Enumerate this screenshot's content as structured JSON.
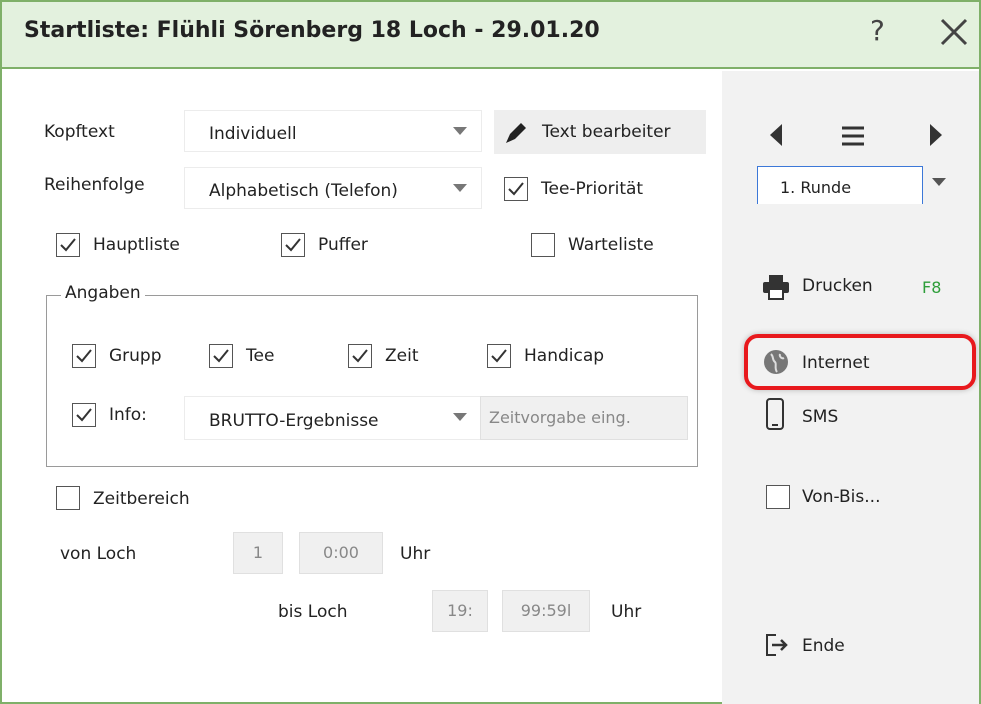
{
  "window": {
    "title": "Startliste: Flühli Sörenberg 18 Loch - 29.01.20",
    "help_glyph": "?"
  },
  "form": {
    "kopftext_label": "Kopftext",
    "kopftext_value": "Individuell",
    "text_bearbeiten_label": "Text bearbeiter",
    "reihenfolge_label": "Reihenfolge",
    "reihenfolge_value": "Alphabetisch (Telefon)",
    "tee_prioritaet_label": "Tee-Priorität",
    "tee_prioritaet_checked": true,
    "hauptliste_label": "Hauptliste",
    "hauptliste_checked": true,
    "puffer_label": "Puffer",
    "puffer_checked": true,
    "warteliste_label": "Warteliste",
    "warteliste_checked": false
  },
  "angaben": {
    "legend": "Angaben",
    "grupp_label": "Grupp",
    "grupp_checked": true,
    "tee_label": "Tee",
    "tee_checked": true,
    "zeit_label": "Zeit",
    "zeit_checked": true,
    "handicap_label": "Handicap",
    "handicap_checked": true,
    "info_label": "Info:",
    "info_checked": true,
    "info_value": "BRUTTO-Ergebnisse",
    "zeitvorgabe_placeholder": "Zeitvorgabe eing."
  },
  "zeitbereich": {
    "label": "Zeitbereich",
    "checked": false,
    "von_loch_label": "von Loch",
    "von_loch_value": "1",
    "von_time": "0:00",
    "uhr_1": "Uhr",
    "bis_loch_label": "bis Loch",
    "bis_loch_value": "19:",
    "bis_time": "99:59l",
    "uhr_2": "Uhr"
  },
  "sidebar": {
    "runde_value": "1. Runde",
    "drucken_label": "Drucken",
    "drucken_shortcut": "F8",
    "internet_label": "Internet",
    "sms_label": "SMS",
    "vonbis_label": "Von-Bis...",
    "ende_label": "Ende",
    "accent_color": "#e8191d",
    "shortcut_color": "#2e9e3a"
  }
}
